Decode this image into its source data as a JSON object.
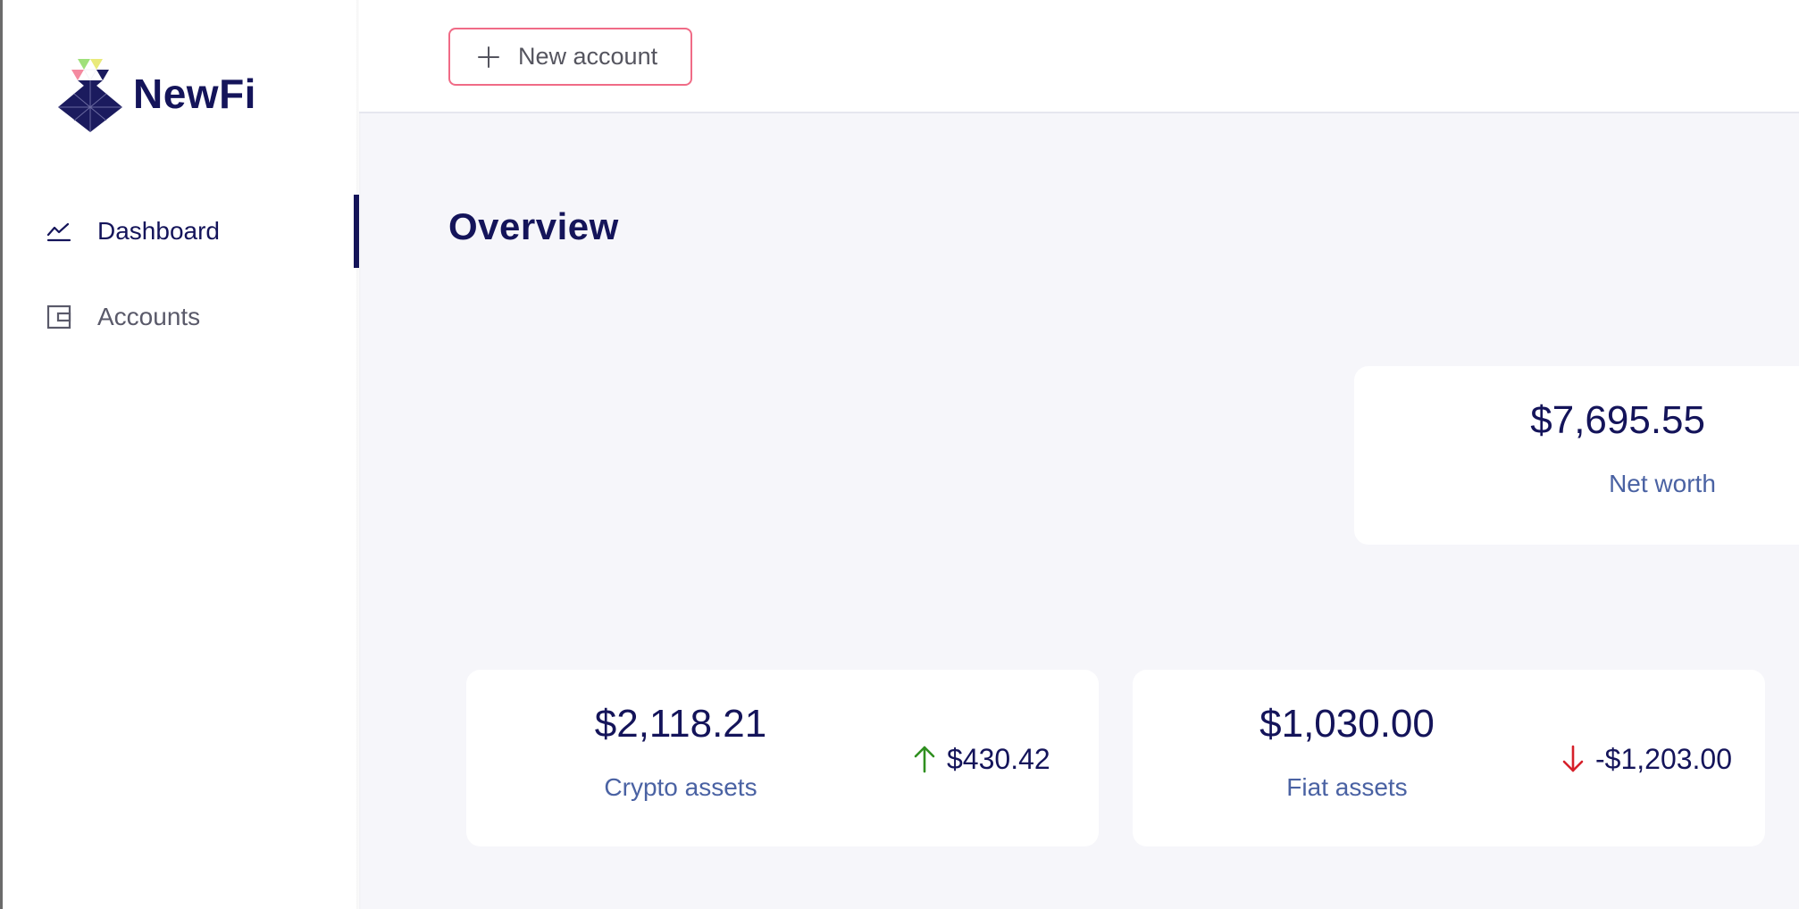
{
  "brand": {
    "name": "NewFi"
  },
  "sidebar": {
    "items": [
      {
        "label": "Dashboard",
        "icon": "chart-line-icon",
        "active": true
      },
      {
        "label": "Accounts",
        "icon": "wallet-icon",
        "active": false
      }
    ]
  },
  "topbar": {
    "new_account_label": "New account",
    "new_account_icon": "plus-icon",
    "new_account_border_color": "#f06b86"
  },
  "main": {
    "title": "Overview",
    "net_worth": {
      "value": "$7,695.55",
      "label": "Net worth"
    },
    "crypto": {
      "value": "$2,118.21",
      "label": "Crypto assets",
      "change": "$430.42",
      "change_direction": "up",
      "change_color": "#2f8f1f"
    },
    "fiat": {
      "value": "$1,030.00",
      "label": "Fiat assets",
      "change": "-$1,203.00",
      "change_direction": "down",
      "change_color": "#d6202a"
    }
  },
  "colors": {
    "primary": "#14145a",
    "accent_text": "#4a62a3",
    "background": "#f6f6fa"
  }
}
